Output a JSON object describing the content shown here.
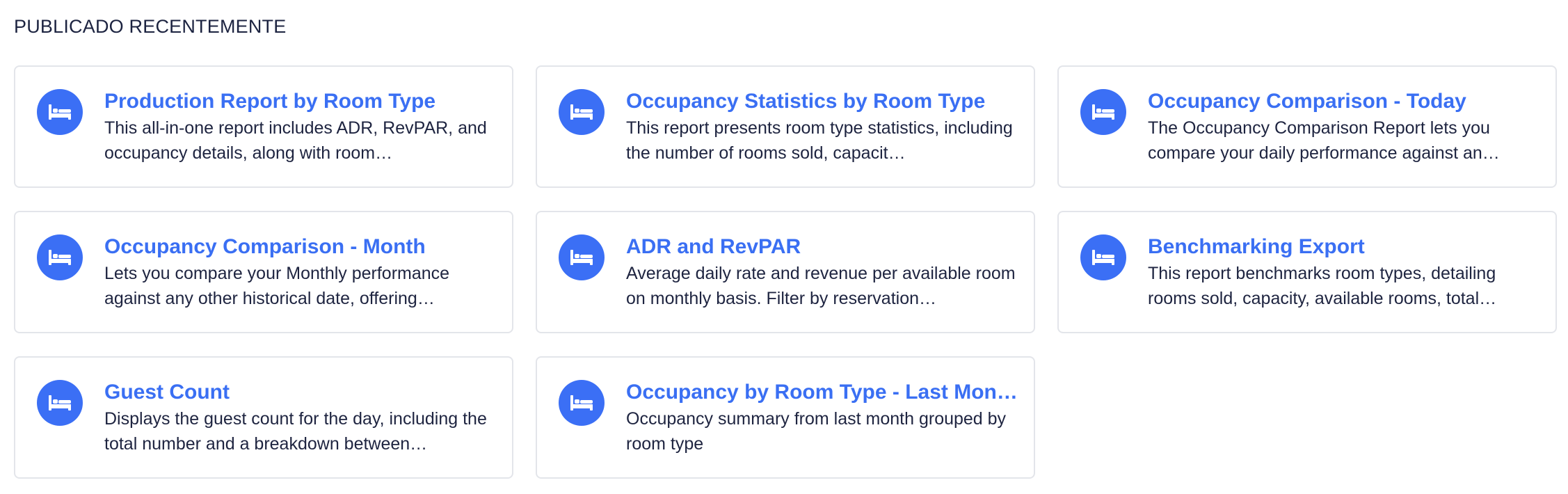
{
  "section": {
    "title": "PUBLICADO RECENTEMENTE"
  },
  "colors": {
    "accent": "#3b6ff5",
    "title_text": "#3a6ff3",
    "body_text": "#1e2440",
    "card_border": "#e3e5ea"
  },
  "reports": [
    {
      "icon": "bed-icon",
      "title": "Production Report by Room Type",
      "description": "This all-in-one report includes ADR, RevPAR, and occupancy details, along with room…"
    },
    {
      "icon": "bed-icon",
      "title": "Occupancy Statistics by Room Type",
      "description": "This report presents room type statistics, including the number of rooms sold, capacit…"
    },
    {
      "icon": "bed-icon",
      "title": "Occupancy Comparison - Today",
      "description": "The Occupancy Comparison Report lets you compare your daily performance against an…"
    },
    {
      "icon": "bed-icon",
      "title": "Occupancy Comparison - Month",
      "description": "Lets you compare your Monthly performance against any other historical date, offering…"
    },
    {
      "icon": "bed-icon",
      "title": "ADR and RevPAR",
      "description": "Average daily rate and revenue per available room on monthly basis. Filter by reservation…"
    },
    {
      "icon": "bed-icon",
      "title": "Benchmarking Export",
      "description": "This report benchmarks room types, detailing rooms sold, capacity, available rooms, total…"
    },
    {
      "icon": "bed-icon",
      "title": "Guest Count",
      "description": "Displays the guest count for the day, including the total number and a breakdown between…"
    },
    {
      "icon": "bed-icon",
      "title": "Occupancy by Room Type - Last Mon…",
      "description": "Occupancy summary from last month grouped by room type"
    }
  ]
}
